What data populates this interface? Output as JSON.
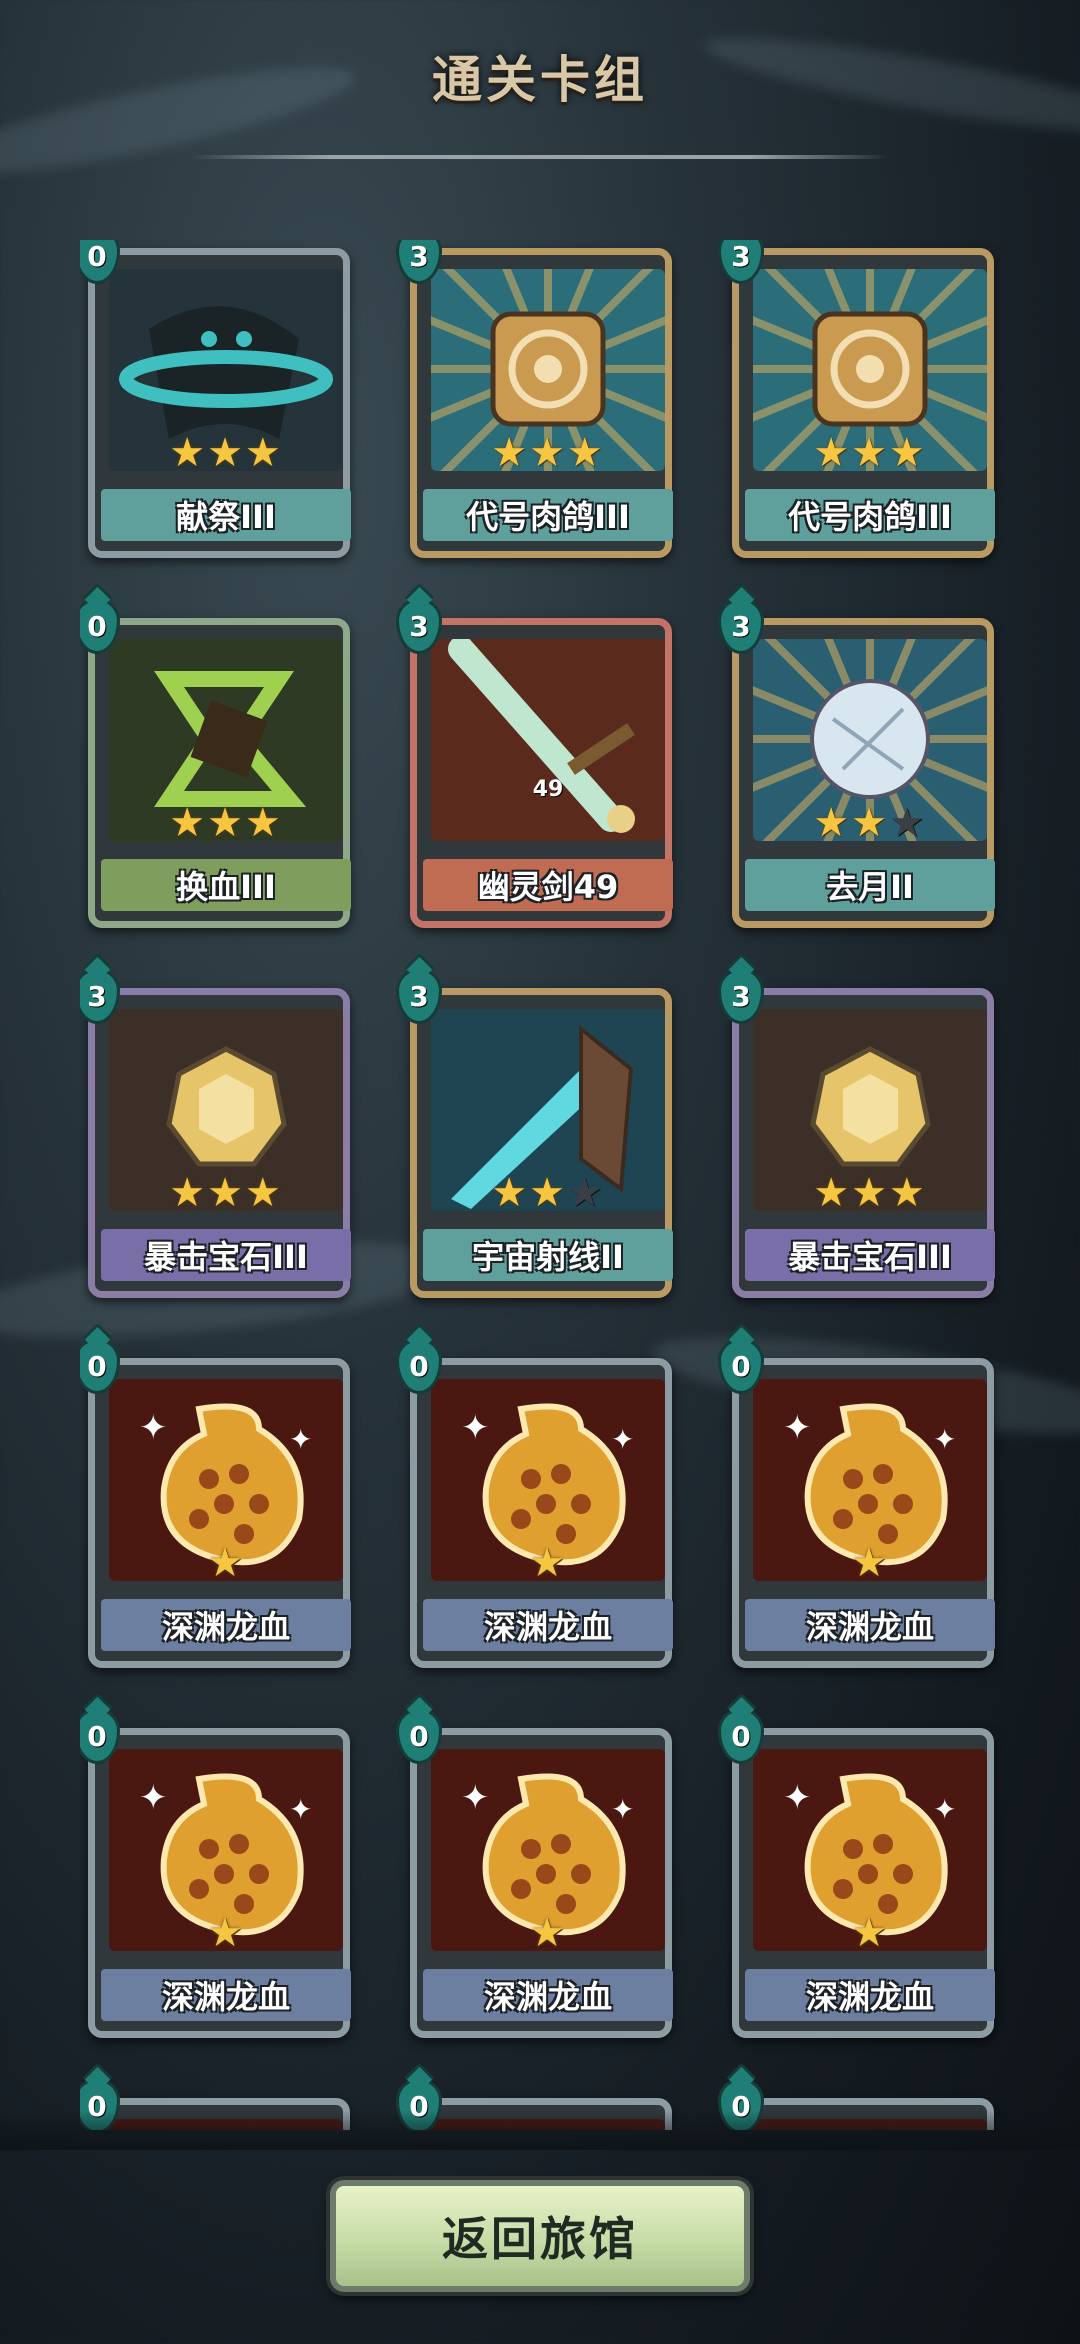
{
  "header": {
    "title": "通关卡组"
  },
  "cards": [
    {
      "name": "献祭III",
      "cost": "0",
      "stars": 3,
      "max_stars": 3,
      "frame": "steel",
      "bar": "#5fa09c",
      "art": "wraith-icon",
      "art_color": "#3fbfbf"
    },
    {
      "name": "代号肉鸽III",
      "cost": "3",
      "stars": 3,
      "max_stars": 3,
      "frame": "gold",
      "bar": "#5fa09c",
      "art": "relic-icon",
      "art_color": "#c99a50"
    },
    {
      "name": "代号肉鸽III",
      "cost": "3",
      "stars": 3,
      "max_stars": 3,
      "frame": "gold",
      "bar": "#5fa09c",
      "art": "relic-icon",
      "art_color": "#c99a50"
    },
    {
      "name": "换血III",
      "cost": "0",
      "stars": 3,
      "max_stars": 3,
      "frame": "green",
      "bar": "#7f9d5c",
      "art": "blood-swap-icon",
      "art_color": "#9fd050"
    },
    {
      "name": "幽灵剑49",
      "cost": "3",
      "stars": 0,
      "max_stars": 0,
      "level": "49",
      "frame": "red",
      "bar": "#c06c52",
      "art": "ghost-sword-icon",
      "art_color": "#b86a34"
    },
    {
      "name": "去月II",
      "cost": "3",
      "stars": 2,
      "max_stars": 3,
      "frame": "gold",
      "bar": "#5fa09c",
      "art": "moon-shard-icon",
      "art_color": "#d8e6f0"
    },
    {
      "name": "暴击宝石III",
      "cost": "3",
      "stars": 3,
      "max_stars": 3,
      "frame": "purple",
      "bar": "#7a6ea8",
      "art": "crit-gem-icon",
      "art_color": "#e6c46a"
    },
    {
      "name": "宇宙射线II",
      "cost": "3",
      "stars": 2,
      "max_stars": 3,
      "frame": "gold",
      "bar": "#5fa09c",
      "art": "cosmic-ray-icon",
      "art_color": "#5fd8e0"
    },
    {
      "name": "暴击宝石III",
      "cost": "3",
      "stars": 3,
      "max_stars": 3,
      "frame": "purple",
      "bar": "#7a6ea8",
      "art": "crit-gem-icon",
      "art_color": "#e6c46a"
    },
    {
      "name": "深渊龙血",
      "cost": "0",
      "stars": 1,
      "max_stars": 1,
      "frame": "steel",
      "bar": "#6c7fa0",
      "art": "dragon-blood-icon",
      "art_color": "#e0a030"
    },
    {
      "name": "深渊龙血",
      "cost": "0",
      "stars": 1,
      "max_stars": 1,
      "frame": "steel",
      "bar": "#6c7fa0",
      "art": "dragon-blood-icon",
      "art_color": "#e0a030"
    },
    {
      "name": "深渊龙血",
      "cost": "0",
      "stars": 1,
      "max_stars": 1,
      "frame": "steel",
      "bar": "#6c7fa0",
      "art": "dragon-blood-icon",
      "art_color": "#e0a030"
    },
    {
      "name": "深渊龙血",
      "cost": "0",
      "stars": 1,
      "max_stars": 1,
      "frame": "steel",
      "bar": "#6c7fa0",
      "art": "dragon-blood-icon",
      "art_color": "#e0a030"
    },
    {
      "name": "深渊龙血",
      "cost": "0",
      "stars": 1,
      "max_stars": 1,
      "frame": "steel",
      "bar": "#6c7fa0",
      "art": "dragon-blood-icon",
      "art_color": "#e0a030"
    },
    {
      "name": "深渊龙血",
      "cost": "0",
      "stars": 1,
      "max_stars": 1,
      "frame": "steel",
      "bar": "#6c7fa0",
      "art": "dragon-blood-icon",
      "art_color": "#e0a030"
    },
    {
      "name": "",
      "cost": "0",
      "stars": 0,
      "max_stars": 0,
      "frame": "steel",
      "bar": "#6c7fa0",
      "art": "dragon-blood-icon",
      "art_color": "#e0a030"
    },
    {
      "name": "",
      "cost": "0",
      "stars": 0,
      "max_stars": 0,
      "frame": "steel",
      "bar": "#6c7fa0",
      "art": "dragon-blood-icon",
      "art_color": "#e0a030"
    },
    {
      "name": "",
      "cost": "0",
      "stars": 0,
      "max_stars": 0,
      "frame": "steel",
      "bar": "#6c7fa0",
      "art": "dragon-blood-icon",
      "art_color": "#e0a030"
    }
  ],
  "footer": {
    "return_label": "返回旅馆"
  }
}
